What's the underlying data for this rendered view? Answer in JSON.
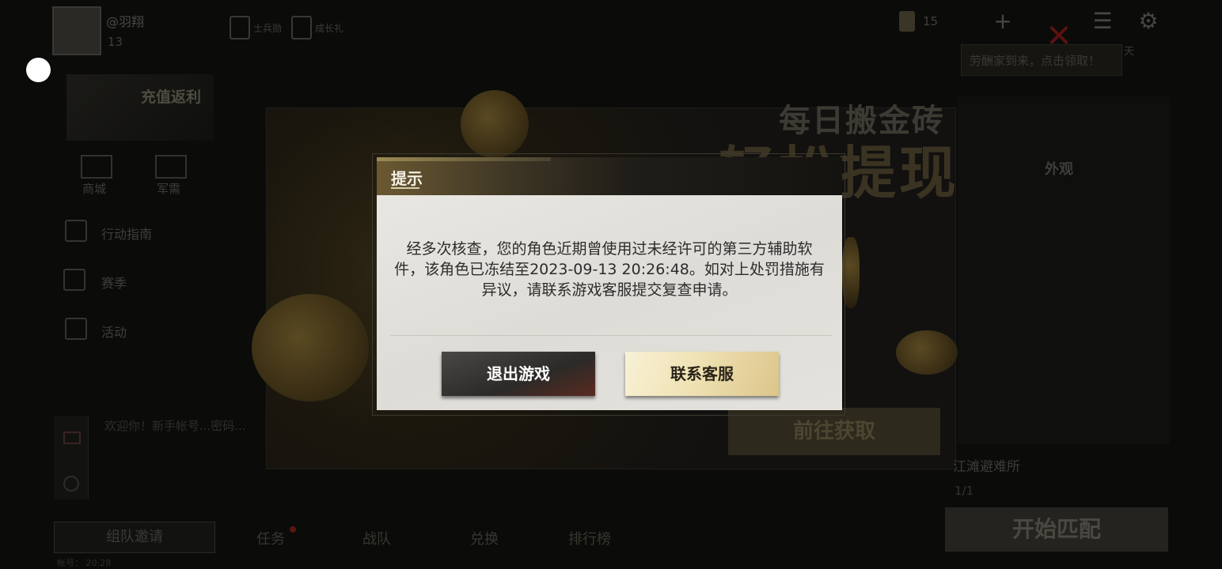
{
  "modal": {
    "title": "提示",
    "message": "经多次核查，您的角色近期曾使用过未经许可的第三方辅助软件，该角色已冻结至2023-09-13 20:26:48。如对上处罚措施有异议，请联系游戏客服提交复查申请。",
    "exit_button": "退出游戏",
    "contact_button": "联系客服"
  },
  "background": {
    "player_name": "@羽翔",
    "player_level": "13",
    "top_items": [
      "士兵勋",
      "成长礼"
    ],
    "currency_value": "15",
    "notice_text": "劳酬家到来，点击领取！",
    "notice_tail": "天",
    "recharge_label": "充值返利",
    "shop_labels": [
      "商城",
      "军需"
    ],
    "side_menu": [
      "行动指南",
      "赛季",
      "活动"
    ],
    "chat_line": "欢迎你！新手帐号...密码...",
    "team_invite": "组队邀请",
    "bottom_tabs": [
      "任务",
      "战队",
      "兑换",
      "排行榜"
    ],
    "bottom_tiny": "帐号：  20:28",
    "banner_line1": "每日搬金砖",
    "banner_line2": "轻松提现",
    "banner_button": "前往获取",
    "outfit_label": "外观",
    "map_name": "江滩避难所",
    "map_count": "1/1",
    "match_button": "开始匹配"
  },
  "icons": {
    "close": "close-x-icon",
    "add": "plus-icon",
    "menu": "list-icon",
    "settings": "gear-icon"
  }
}
